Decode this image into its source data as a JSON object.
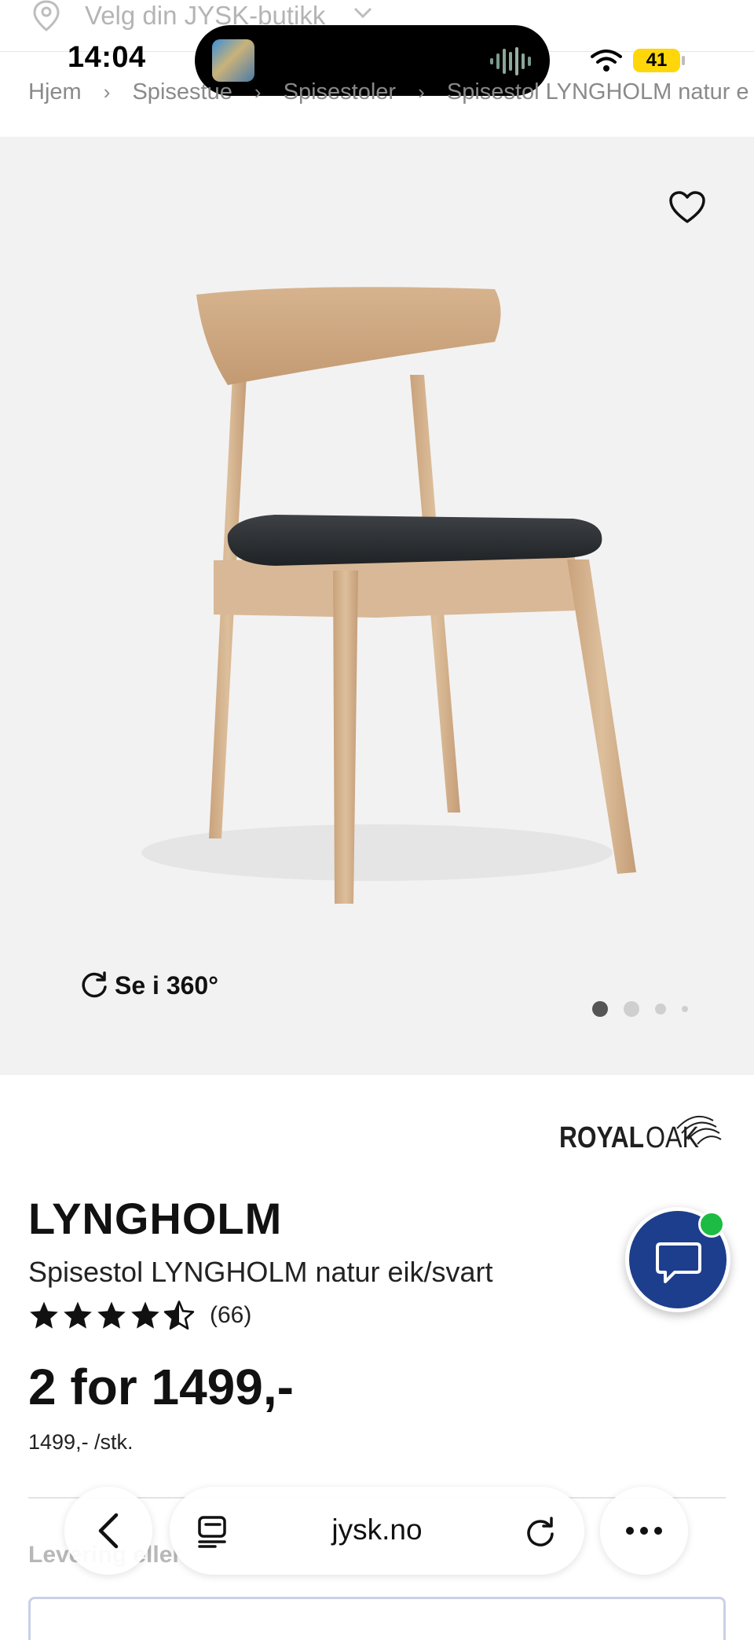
{
  "status_bar": {
    "time": "14:04",
    "battery": "41"
  },
  "store_selector": {
    "label": "Velg din JYSK-butikk"
  },
  "breadcrumb": [
    "Hjem",
    "Spisestue",
    "Spisestoler",
    "Spisestol LYNGHOLM natur e"
  ],
  "gallery": {
    "view_360_label": "Se i 360°",
    "image_count": 4,
    "active_index": 0
  },
  "product": {
    "brand": "ROYALOAK",
    "title": "LYNGHOLM",
    "subtitle": "Spisestol LYNGHOLM natur eik/svart",
    "rating_value": 4.5,
    "rating_count": "(66)",
    "price": "2 for 1499,-",
    "unit_price": "1499,- /stk."
  },
  "delivery": {
    "label": "Levering eller"
  },
  "browser": {
    "url": "jysk.no"
  },
  "colors": {
    "brand_blue": "#1d3e8c",
    "online_green": "#1dbb43",
    "battery_yellow": "#ffd60a"
  }
}
